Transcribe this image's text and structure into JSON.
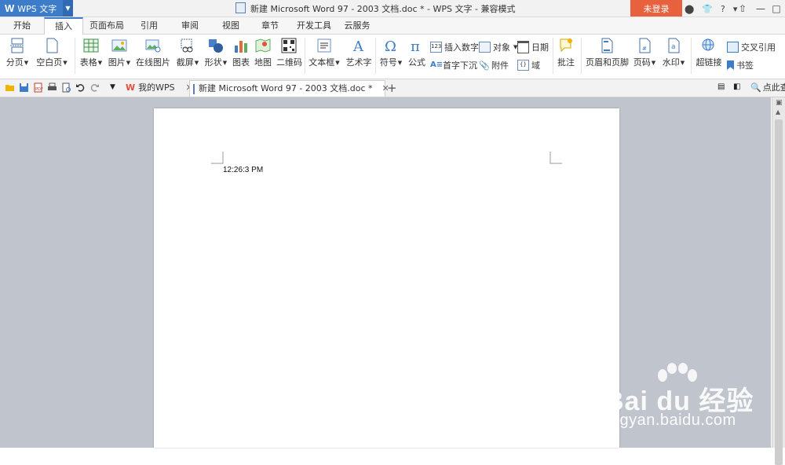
{
  "titlebar": {
    "app_name": "WPS 文字",
    "window_title": "新建 Microsoft Word 97 - 2003 文档.doc * - WPS 文字 - 兼容模式",
    "login_label": "未登录"
  },
  "menu_tabs": [
    "开始",
    "插入",
    "页面布局",
    "引用",
    "审阅",
    "视图",
    "章节",
    "开发工具",
    "云服务"
  ],
  "active_tab": "插入",
  "ribbon": {
    "page_break": "分页",
    "blank_page": "空白页",
    "table": "表格",
    "picture": "图片",
    "online_picture": "在线图片",
    "screenshot": "截屏",
    "shape": "形状",
    "chart": "图表",
    "map": "地图",
    "qrcode": "二维码",
    "textbox": "文本框",
    "wordart": "艺术字",
    "symbol": "符号",
    "formula": "公式",
    "insert_number": "插入数字",
    "object": "对象",
    "date": "日期",
    "drop_cap": "首字下沉",
    "attachment": "附件",
    "field": "域",
    "comment": "批注",
    "header_footer": "页眉和页脚",
    "page_number": "页码",
    "watermark": "水印",
    "hyperlink": "超链接",
    "cross_reference": "交叉引用",
    "bookmark": "书签"
  },
  "doc_tabs": {
    "my_wps": "我的WPS",
    "current_doc": "新建 Microsoft Word 97 - 2003 文档.doc *"
  },
  "quick_search": "点此查",
  "document": {
    "timestamp_text": "12:26:3 PM"
  },
  "watermark": {
    "brand": "Bai du 经验",
    "url": "jingyan.baidu.com"
  }
}
